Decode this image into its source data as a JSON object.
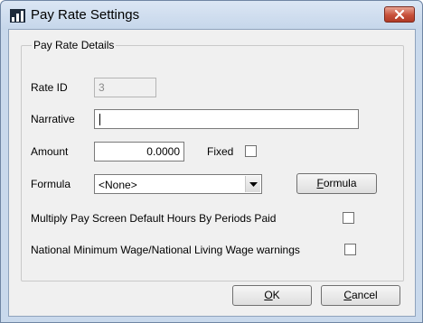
{
  "window": {
    "title": "Pay Rate Settings",
    "icon": "chart-bars-icon",
    "close_icon": "close-x-icon",
    "close_color": "#c7503a"
  },
  "group": {
    "label": "Pay Rate Details"
  },
  "fields": {
    "rate_id": {
      "label": "Rate ID",
      "value": "3"
    },
    "narrative": {
      "label": "Narrative",
      "value": ""
    },
    "amount": {
      "label": "Amount",
      "value": "0.0000"
    },
    "fixed": {
      "label": "Fixed",
      "checked": false
    },
    "formula": {
      "label": "Formula",
      "selected": "<None>"
    },
    "multiply": {
      "label": "Multiply Pay Screen Default Hours By Periods Paid",
      "checked": false
    },
    "min_wage": {
      "label": "National Minimum Wage/National Living Wage warnings",
      "checked": false
    }
  },
  "buttons": {
    "formula": {
      "first": "F",
      "rest": "ormula"
    },
    "ok": {
      "first": "O",
      "rest": "K"
    },
    "cancel": {
      "first": "C",
      "rest": "ancel"
    }
  }
}
